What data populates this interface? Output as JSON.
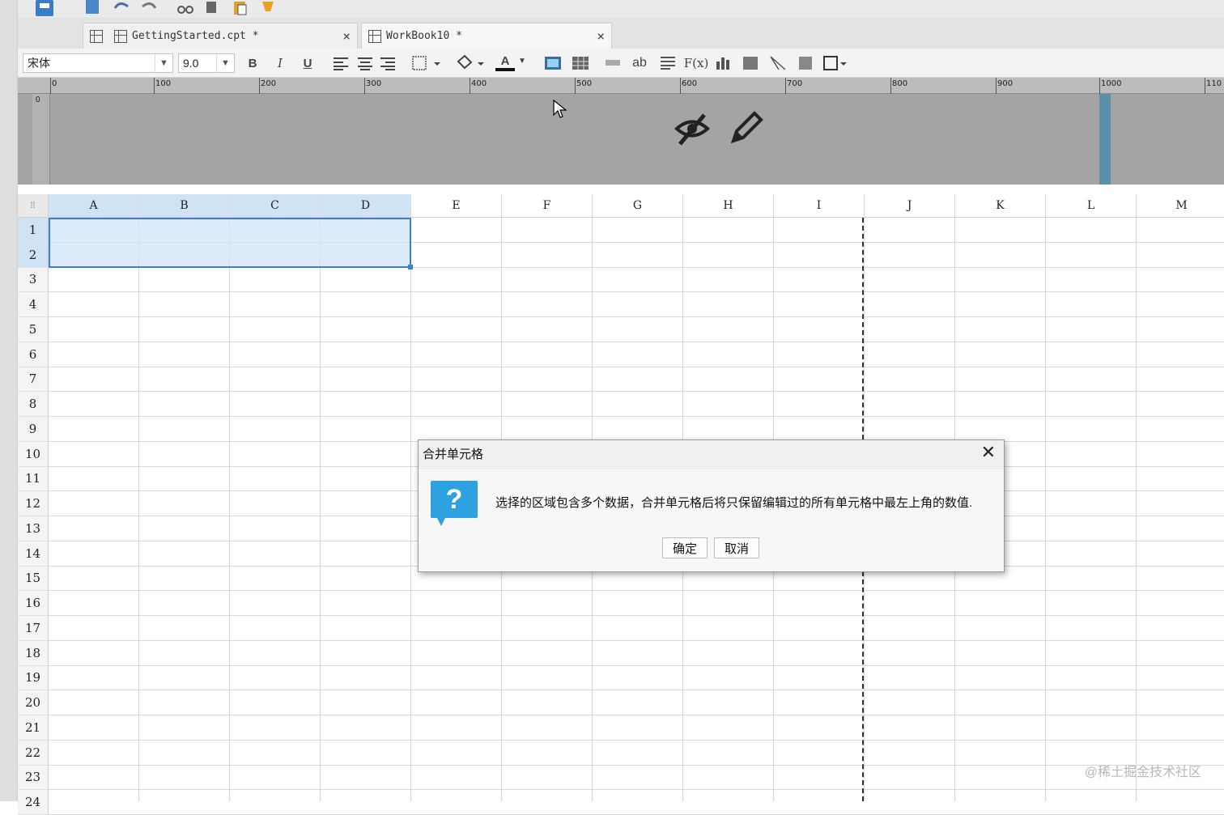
{
  "tabs": [
    {
      "label": "GettingStarted.cpt *",
      "close": "×"
    },
    {
      "label": "WorkBook10 *",
      "close": "×"
    }
  ],
  "toolbar": {
    "font_family": "宋体",
    "font_size": "9.0",
    "bold": "B",
    "italic": "I",
    "underline": "U",
    "font_color_glyph": "A",
    "text_ab": "ab",
    "formula": "F(x)"
  },
  "ruler": {
    "ticks": [
      "0",
      "100",
      "200",
      "300",
      "400",
      "500",
      "600",
      "700",
      "800",
      "900",
      "1000",
      "110"
    ],
    "vertical_zero": "0"
  },
  "sheet": {
    "columns": [
      "A",
      "B",
      "C",
      "D",
      "E",
      "F",
      "G",
      "H",
      "I",
      "J",
      "K",
      "L",
      "M"
    ],
    "rows": [
      "1",
      "2",
      "3",
      "4",
      "5",
      "6",
      "7",
      "8",
      "9",
      "10",
      "11",
      "12",
      "13",
      "14",
      "15",
      "16",
      "17",
      "18",
      "19",
      "20",
      "21",
      "22",
      "23",
      "24"
    ],
    "selected_columns": [
      "A",
      "B",
      "C",
      "D"
    ],
    "selected_rows": [
      "1",
      "2"
    ]
  },
  "dialog": {
    "title": "合并单元格",
    "message": "选择的区域包含多个数据，合并单元格后将只保留编辑过的所有单元格中最左上角的数值.",
    "ok_label": "确定",
    "cancel_label": "取消",
    "icon": "question-icon",
    "icon_glyph": "?"
  },
  "watermark": "@稀土掘金技术社区",
  "colors": {
    "accent": "#3d7ed8",
    "selection": "#cfe3f5",
    "dialog_icon": "#2fa0e0",
    "header_band": "#a4a4a4"
  }
}
